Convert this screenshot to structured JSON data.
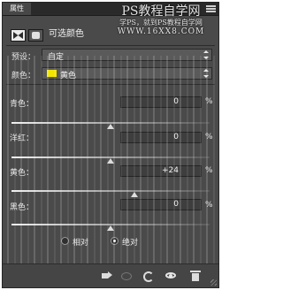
{
  "panel": {
    "tab_label": "属性",
    "header_title": "可选颜色",
    "menu_icon": "panel-menu-icon"
  },
  "watermark": {
    "line1": "PS教程自学网",
    "line2": "学PS，就到PS教程自学网",
    "line3": "WWW.16XX8.COM"
  },
  "preset": {
    "label": "预设：",
    "value": "自定"
  },
  "colors": {
    "label": "颜色：",
    "value": "黄色",
    "swatch_color": "#f2e600"
  },
  "sliders": [
    {
      "label": "青色：",
      "value": "0",
      "unit": "%",
      "level": 0
    },
    {
      "label": "洋红：",
      "value": "0",
      "unit": "%",
      "level": 0
    },
    {
      "label": "黄色：",
      "value": "+24",
      "unit": "%",
      "level": 24
    },
    {
      "label": "黑色：",
      "value": "0",
      "unit": "%",
      "level": 0
    }
  ],
  "method": {
    "relative_label": "相对",
    "absolute_label": "绝对",
    "selected": "absolute"
  },
  "footer_icons": [
    "clip-to-layer-icon",
    "view-previous-icon",
    "reset-icon",
    "visibility-eye-icon",
    "delete-icon"
  ]
}
